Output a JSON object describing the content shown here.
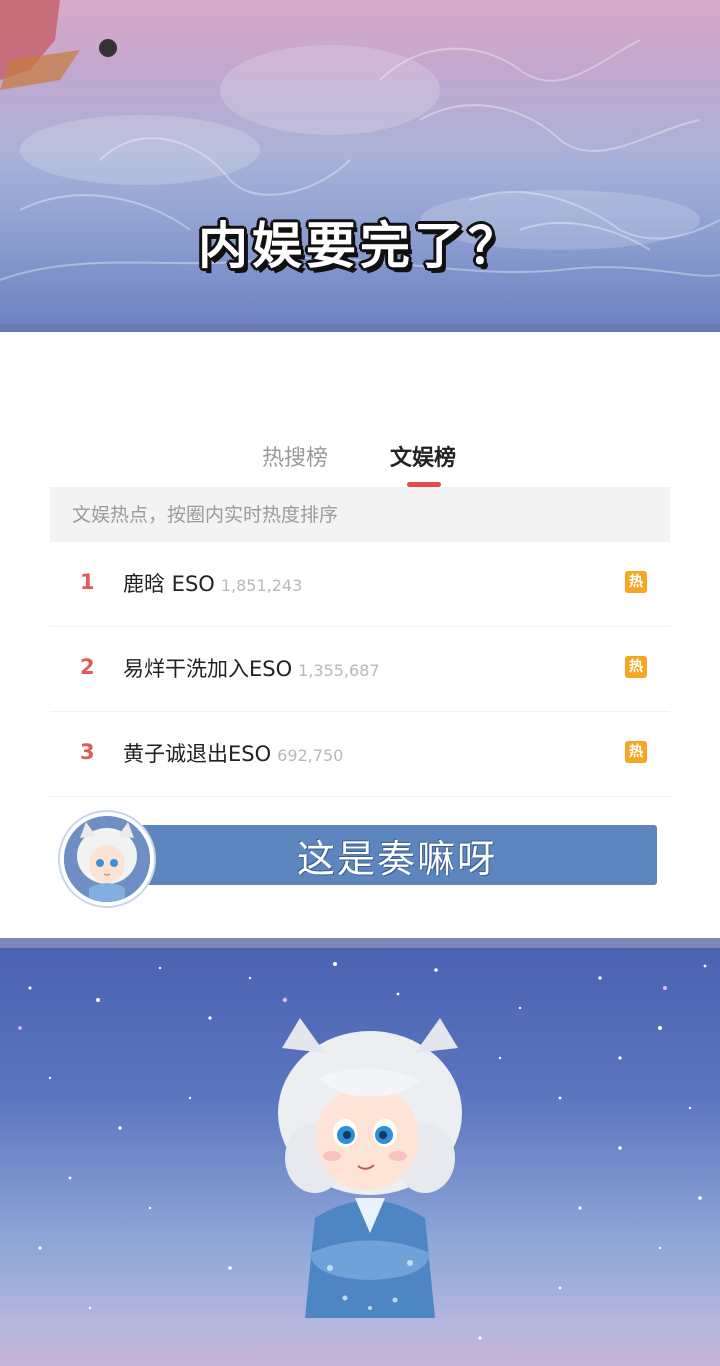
{
  "banner": {
    "title": "内娱要完了？"
  },
  "tabs": [
    {
      "label": "热搜榜",
      "active": false
    },
    {
      "label": "文娱榜",
      "active": true
    }
  ],
  "search": {
    "placeholder": "文娱热点，按圈内实时热度排序"
  },
  "rank_list": [
    {
      "rank": "1",
      "title": "鹿晗 ESO",
      "count": "1,851,243",
      "badge": "热"
    },
    {
      "rank": "2",
      "title": "易烊干洗加入ESO",
      "count": "1,355,687",
      "badge": "热"
    },
    {
      "rank": "3",
      "title": "黄子诚退出ESO",
      "count": "692,750",
      "badge": "热"
    }
  ],
  "caption": {
    "text": "这是奏嘛呀"
  },
  "colors": {
    "accent_red": "#e24c4c",
    "hot_badge": "#f5a623",
    "caption_bg": "#5e86be"
  }
}
